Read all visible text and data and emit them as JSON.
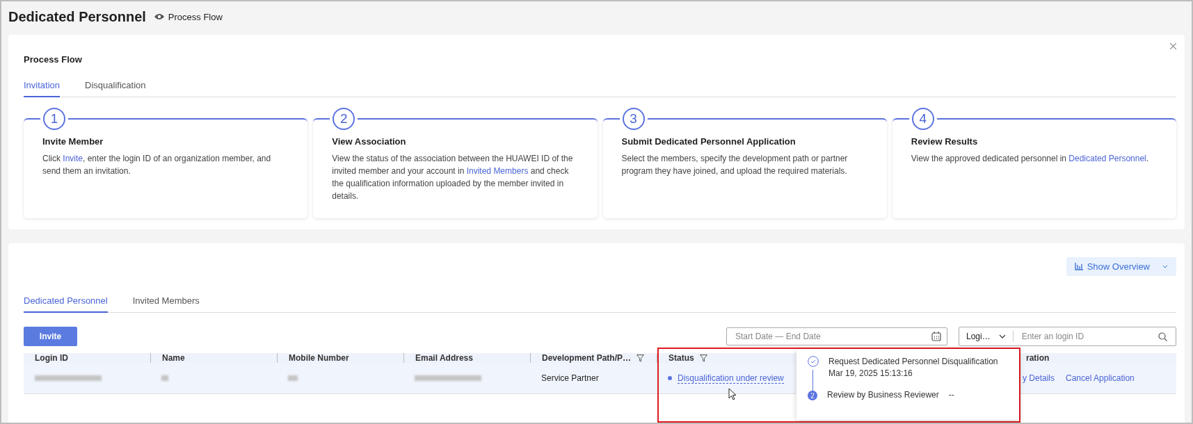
{
  "page": {
    "title": "Dedicated Personnel",
    "link": "Process Flow"
  },
  "process_flow": {
    "title": "Process Flow",
    "tabs": [
      {
        "label": "Invitation",
        "selected": true
      },
      {
        "label": "Disqualification",
        "selected": false
      }
    ],
    "steps": [
      {
        "number": "1",
        "title": "Invite Member",
        "description": [
          {
            "kind": "text",
            "text": "Click "
          },
          {
            "kind": "link",
            "text": "Invite"
          },
          {
            "kind": "text",
            "text": ", enter the login ID of an organization member, and send them an invitation."
          }
        ]
      },
      {
        "number": "2",
        "title": "View Association",
        "description": [
          {
            "kind": "text",
            "text": "View the status of the association between the HUAWEI ID of the invited member and your account in "
          },
          {
            "kind": "link",
            "text": "Invited Members"
          },
          {
            "kind": "text",
            "text": " and check the qualification information uploaded by the member invited in details."
          }
        ]
      },
      {
        "number": "3",
        "title": "Submit Dedicated Personnel Application",
        "description": [
          {
            "kind": "text",
            "text": "Select the members, specify the development path or partner program they have joined, and upload the required materials."
          }
        ]
      },
      {
        "number": "4",
        "title": "Review Results",
        "description": [
          {
            "kind": "text",
            "text": "View the approved dedicated personnel in "
          },
          {
            "kind": "link",
            "text": "Dedicated Personnel"
          },
          {
            "kind": "text",
            "text": "."
          }
        ]
      }
    ]
  },
  "personnel": {
    "overview_button": "Show Overview",
    "tabs": [
      {
        "label": "Dedicated Personnel",
        "selected": true
      },
      {
        "label": "Invited Members",
        "selected": false
      }
    ],
    "invite_button": "Invite",
    "date_range": {
      "placeholder": "Start Date — End Date"
    },
    "search": {
      "field_select": "Logi…",
      "placeholder": "Enter an login ID"
    },
    "table": {
      "columns": [
        {
          "label": "Login ID",
          "filter": false
        },
        {
          "label": "Name",
          "filter": false
        },
        {
          "label": "Mobile Number",
          "filter": false
        },
        {
          "label": "Email Address",
          "filter": false
        },
        {
          "label": "Development Path/P…",
          "filter": true
        },
        {
          "label": "Status",
          "filter": true
        },
        {
          "label": "ration",
          "filter": false
        }
      ],
      "rows": [
        {
          "cells": [
            {
              "kind": "redacted"
            },
            {
              "kind": "redacted"
            },
            {
              "kind": "redacted"
            },
            {
              "kind": "redacted"
            },
            {
              "kind": "text",
              "text": "Service Partner"
            },
            {
              "kind": "status",
              "text": "Disqualification under review",
              "color": "#5b73e0"
            },
            {
              "kind": "links",
              "links": [
                "y Details",
                "Cancel Application"
              ]
            }
          ]
        }
      ]
    }
  },
  "status_popover": {
    "steps": [
      {
        "done": true,
        "title": "Request Dedicated Personnel Disqualification",
        "time": "Mar 19, 2025 15:13:16"
      },
      {
        "done": false,
        "number": "2",
        "title": "Review by Business Reviewer",
        "time": "--"
      }
    ]
  }
}
